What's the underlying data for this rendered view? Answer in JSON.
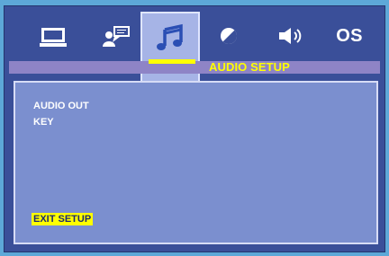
{
  "tabs": [
    {
      "icon": "monitor-icon"
    },
    {
      "icon": "user-speech-icon"
    },
    {
      "icon": "music-note-icon",
      "selected": true
    },
    {
      "icon": "contrast-icon"
    },
    {
      "icon": "speaker-icon"
    },
    {
      "label": "OS"
    }
  ],
  "header": {
    "title": "AUDIO SETUP"
  },
  "menu": {
    "items": [
      "AUDIO OUT",
      "KEY"
    ]
  },
  "exit_label": "EXIT SETUP",
  "colors": {
    "background": "#5da8d8",
    "frame": "#3a4f99",
    "header_bar": "#8e84c6",
    "content": "#7b8fcf",
    "highlight": "#ffff00"
  }
}
